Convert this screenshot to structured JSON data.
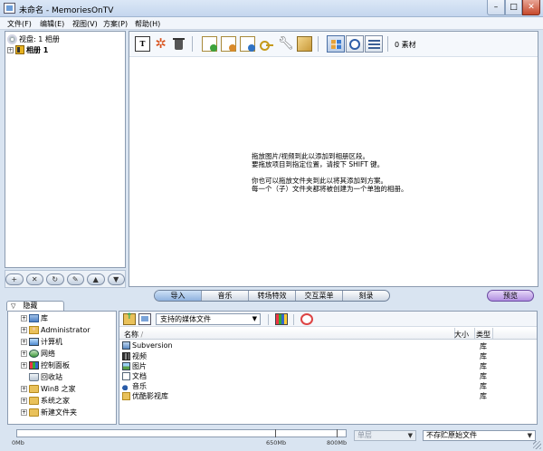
{
  "window": {
    "title": "未命名 - MemoriesOnTV",
    "controls": {
      "minimize": "–",
      "maximize": "□",
      "close": "✕"
    }
  },
  "menu": {
    "file": "文件(F)",
    "edit": "编辑(E)",
    "view": "视图(V)",
    "scheme": "方案(P)",
    "help": "帮助(H)"
  },
  "album_tree": {
    "disc_label": "视盘: 1 相册",
    "album_label": "相册 1"
  },
  "tree_tools": [
    "+",
    "✕",
    "↻",
    "✎",
    "▲",
    "▼"
  ],
  "content_toolbar": {
    "text_icon": "T",
    "material_count": "0 素材"
  },
  "drop_hint": {
    "line1": "拖放图片/视频到此以添加到相册区段。",
    "line2": "要拖放项目到指定位置，请按下 SHIFT 键。",
    "line3": "你也可以拖放文件夹到此以将其添加到方案。",
    "line4": "每一个（子）文件夹都将被创建为一个单独的相册。"
  },
  "mode_tabs": {
    "import": "导入",
    "music": "音乐",
    "transitions": "转场特效",
    "interactive_menu": "交互菜单",
    "burn": "刻录"
  },
  "preview_label": "预览",
  "hide_tab": {
    "arrow": "▽",
    "label": "隐藏"
  },
  "folder_tree": {
    "items": [
      {
        "label": "库",
        "icon": "library-icon",
        "expandable": true
      },
      {
        "label": "Administrator",
        "icon": "user-icon",
        "expandable": true
      },
      {
        "label": "计算机",
        "icon": "computer-icon",
        "expandable": true
      },
      {
        "label": "网络",
        "icon": "network-icon",
        "expandable": true
      },
      {
        "label": "控制面板",
        "icon": "control-panel-icon",
        "expandable": true
      },
      {
        "label": "回收站",
        "icon": "recycle-icon",
        "expandable": false
      },
      {
        "label": "Win8 之家",
        "icon": "folder-icon",
        "expandable": true
      },
      {
        "label": "系统之家",
        "icon": "folder-icon",
        "expandable": true
      },
      {
        "label": "新建文件夹",
        "icon": "folder-icon",
        "expandable": true
      }
    ]
  },
  "file_browser": {
    "filter_value": "支持的媒体文件",
    "columns": {
      "name": "名称",
      "sort_arrow": "/",
      "size": "大小",
      "type": "类型"
    },
    "rows": [
      {
        "name": "Subversion",
        "type": "库",
        "icon": "subversion-icon"
      },
      {
        "name": "视频",
        "type": "库",
        "icon": "video-icon"
      },
      {
        "name": "图片",
        "type": "库",
        "icon": "picture-icon"
      },
      {
        "name": "文档",
        "type": "库",
        "icon": "document-icon"
      },
      {
        "name": "音乐",
        "type": "库",
        "icon": "music-icon"
      },
      {
        "name": "优酷影视库",
        "type": "库",
        "icon": "yk-folder-icon"
      }
    ]
  },
  "status": {
    "capacity_labels": {
      "start": "0Mb",
      "mid": "650Mb",
      "end": "800Mb"
    },
    "layer_value": "单层",
    "keep_value": "不存贮原始文件"
  }
}
